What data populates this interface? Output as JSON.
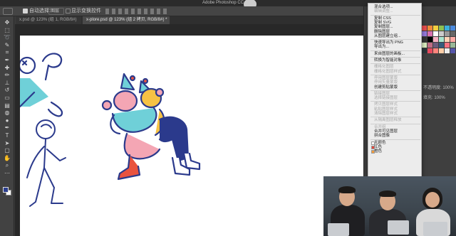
{
  "window": {
    "title": "Adobe Photoshop CC"
  },
  "options_bar": {
    "auto_select_label": "自动选择:",
    "auto_select_value": "图层",
    "show_transform_label": "显示变换控件"
  },
  "tabs": [
    {
      "label": "x.psd @ 123% (组 1, RGB/8#)"
    },
    {
      "label": "x-plore.psd @ 123% (组 2 拷贝, RGB/8#) *"
    }
  ],
  "tools": [
    "move-icon",
    "marquee-icon",
    "lasso-icon",
    "quick-select-icon",
    "crop-icon",
    "eyedropper-icon",
    "healing-icon",
    "brush-icon",
    "stamp-icon",
    "history-brush-icon",
    "eraser-icon",
    "gradient-icon",
    "blur-icon",
    "dodge-icon",
    "pen-icon",
    "type-icon",
    "path-select-icon",
    "shape-icon",
    "hand-icon",
    "zoom-icon",
    "more-icon"
  ],
  "colors": {
    "foreground": "#2c3f8f",
    "background": "#ffffff",
    "illustration_navy": "#2b3a8c",
    "illustration_pink": "#f4a6b4",
    "illustration_teal": "#6fd0d8",
    "illustration_yellow": "#f6c244",
    "illustration_red": "#e9533f"
  },
  "context_menu": {
    "items": [
      {
        "label": "混合选项...",
        "enabled": true
      },
      {
        "label": "编辑调整...",
        "enabled": false
      },
      {
        "sep": true
      },
      {
        "label": "复制 CSS",
        "enabled": true
      },
      {
        "label": "复制 SVG",
        "enabled": true
      },
      {
        "label": "复制图层...",
        "enabled": true
      },
      {
        "label": "删除图层",
        "enabled": true
      },
      {
        "label": "从图层建立组...",
        "enabled": true
      },
      {
        "sep": true
      },
      {
        "label": "快速导出为 PNG",
        "enabled": true
      },
      {
        "label": "导出为...",
        "enabled": true
      },
      {
        "sep": true
      },
      {
        "label": "来自图层的画板...",
        "enabled": true
      },
      {
        "sep": true
      },
      {
        "label": "转换为智能对象",
        "enabled": true
      },
      {
        "sep": true
      },
      {
        "label": "栅格化图层",
        "enabled": false
      },
      {
        "label": "栅格化图层样式",
        "enabled": false
      },
      {
        "sep": true
      },
      {
        "label": "停用图层蒙版",
        "enabled": false
      },
      {
        "label": "停用矢量蒙版",
        "enabled": false
      },
      {
        "label": "创建剪贴蒙版",
        "enabled": true
      },
      {
        "sep": true
      },
      {
        "label": "链接图层",
        "enabled": false
      },
      {
        "label": "选择链接图层",
        "enabled": false
      },
      {
        "sep": true
      },
      {
        "label": "拷贝图层样式",
        "enabled": false
      },
      {
        "label": "粘贴图层样式",
        "enabled": false
      },
      {
        "label": "清除图层样式",
        "enabled": false
      },
      {
        "sep": true
      },
      {
        "label": "从隔离图层释放",
        "enabled": false
      },
      {
        "sep": true
      },
      {
        "label": "合并组",
        "enabled": false
      },
      {
        "label": "合并可见图层",
        "enabled": true
      },
      {
        "label": "拼合图像",
        "enabled": true
      },
      {
        "sep": true
      },
      {
        "label": "无颜色",
        "enabled": true,
        "swatch": "#ffffff"
      },
      {
        "label": "红色",
        "enabled": true,
        "swatch": "#e2463a"
      },
      {
        "label": "橙色",
        "enabled": true,
        "swatch": "#f29a3a"
      }
    ]
  },
  "layers_panel": {
    "opacity_label": "不透明度: 100%",
    "fill_label": "填充: 100%"
  },
  "swatches": [
    "#e94d4d",
    "#f08a3a",
    "#f4d03f",
    "#8cc152",
    "#3bafda",
    "#4a89dc",
    "#967adc",
    "#d770ad",
    "#ffffff",
    "#cccccc",
    "#999999",
    "#666666",
    "#333333",
    "#000000",
    "#f6b1c3",
    "#a8e6cf",
    "#ffd3b6",
    "#ffaaa5",
    "#dcedc1",
    "#c06c84",
    "#6c5b7b",
    "#355c7d",
    "#f67280",
    "#99b898",
    "#2a363b",
    "#e84a5f",
    "#ff847c",
    "#fecea8",
    "#eeeeee",
    "#55a"
  ]
}
